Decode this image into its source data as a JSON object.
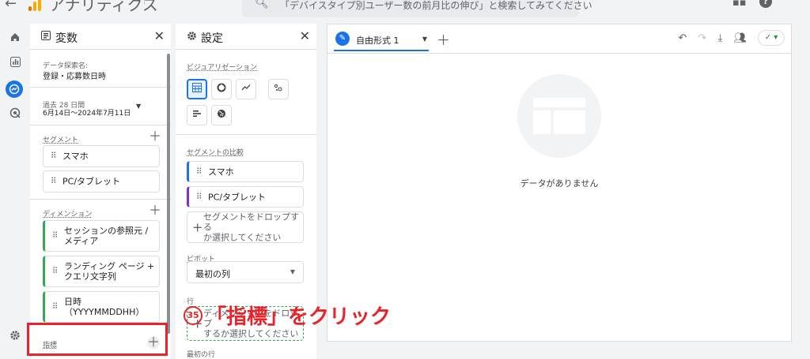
{
  "topbar": {
    "back_glyph": "←",
    "app_title": "アナリティクス",
    "property_selector": "",
    "search_placeholder": "「デバイスタイプ別ユーザー数の前月比の伸び」と検索してみてください",
    "brand_colors": {
      "logo_orange": "#f9ab00",
      "logo_dark": "#e37400"
    }
  },
  "leftnav": {
    "items": [
      "home-icon",
      "reports-icon",
      "explore-icon",
      "advertising-icon"
    ],
    "active": "explore-icon",
    "bottom": "settings-icon"
  },
  "variables_panel": {
    "title": "変数",
    "exploration_name_label": "データ探索名:",
    "exploration_name": "登録・応募数日時",
    "date_range_label": "過去 28 日間",
    "date_range_value": "6月14日～2024年7月11日",
    "segments_label": "セグメント",
    "segments": [
      "スマホ",
      "PC/タブレット"
    ],
    "dimensions_label": "ディメンション",
    "dimensions": [
      {
        "l1": "セッションの参照元 /",
        "l2": "メディア"
      },
      {
        "l1": "ランディング ページ +",
        "l2": "クエリ文字列"
      },
      {
        "l1": "日時",
        "l2": "（YYYYMMDDHH）"
      }
    ],
    "metrics_label": "指標"
  },
  "settings_panel": {
    "title": "設定",
    "visualization_label": "ビジュアリゼーション",
    "visualization_types": [
      "table-icon",
      "donut-icon",
      "line-icon",
      "scatter-icon",
      "bar-icon",
      "geo-icon"
    ],
    "segment_comparison_label": "セグメントの比較",
    "segment_comparison": [
      "スマホ",
      "PC/タブレット"
    ],
    "segment_drop_l1": "セグメントをドロップする",
    "segment_drop_l2": "か選択してください",
    "pivot_label": "ピボット",
    "pivot_value": "最初の列",
    "rows_label": "行",
    "rows_drop_l1": "ディメンションをドロップ",
    "rows_drop_l2": "するか選択してください",
    "first_row_label": "最初の行"
  },
  "canvas": {
    "tab_label": "自由形式 1",
    "no_data": "データがありません",
    "colors": {
      "accent": "#1a73e8",
      "status": "#1e8e3e"
    }
  },
  "annotation": {
    "step": "35",
    "text": "「指標」をクリック",
    "color": "#e8242a"
  }
}
